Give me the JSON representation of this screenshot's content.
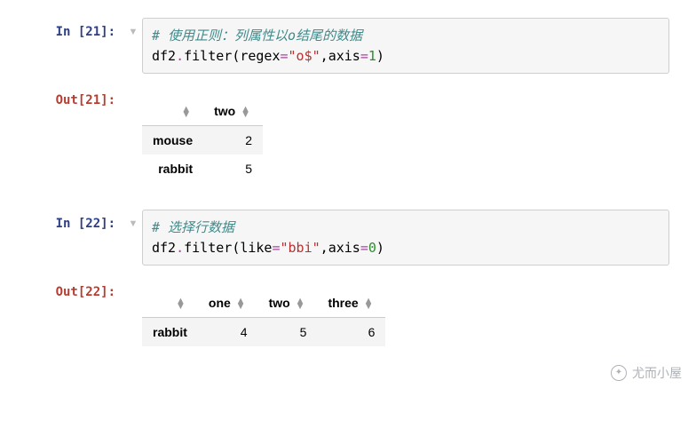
{
  "cells": [
    {
      "in_prompt": "In [21]:",
      "out_prompt": "Out[21]:",
      "comment": "# 使用正则：列属性以o结尾的数据",
      "code": {
        "obj": "df2",
        "method": "filter",
        "arg1_key": "regex",
        "arg1_val": "\"o$\"",
        "arg2_key": "axis",
        "arg2_val": "1"
      },
      "table": {
        "columns": [
          "two"
        ],
        "index": [
          "mouse",
          "rabbit"
        ],
        "rows": [
          [
            "2"
          ],
          [
            "5"
          ]
        ]
      }
    },
    {
      "in_prompt": "In [22]:",
      "out_prompt": "Out[22]:",
      "comment": "# 选择行数据",
      "code": {
        "obj": "df2",
        "method": "filter",
        "arg1_key": "like",
        "arg1_val": "\"bbi\"",
        "arg2_key": "axis",
        "arg2_val": "0"
      },
      "table": {
        "columns": [
          "one",
          "two",
          "three"
        ],
        "index": [
          "rabbit"
        ],
        "rows": [
          [
            "4",
            "5",
            "6"
          ]
        ]
      }
    }
  ],
  "chart_data": [
    {
      "type": "table",
      "title": "df2.filter(regex=\"o$\", axis=1)",
      "columns": [
        "two"
      ],
      "index": [
        "mouse",
        "rabbit"
      ],
      "data": [
        [
          2
        ],
        [
          5
        ]
      ]
    },
    {
      "type": "table",
      "title": "df2.filter(like=\"bbi\", axis=0)",
      "columns": [
        "one",
        "two",
        "three"
      ],
      "index": [
        "rabbit"
      ],
      "data": [
        [
          4,
          5,
          6
        ]
      ]
    }
  ],
  "watermark": "尤而小屋"
}
